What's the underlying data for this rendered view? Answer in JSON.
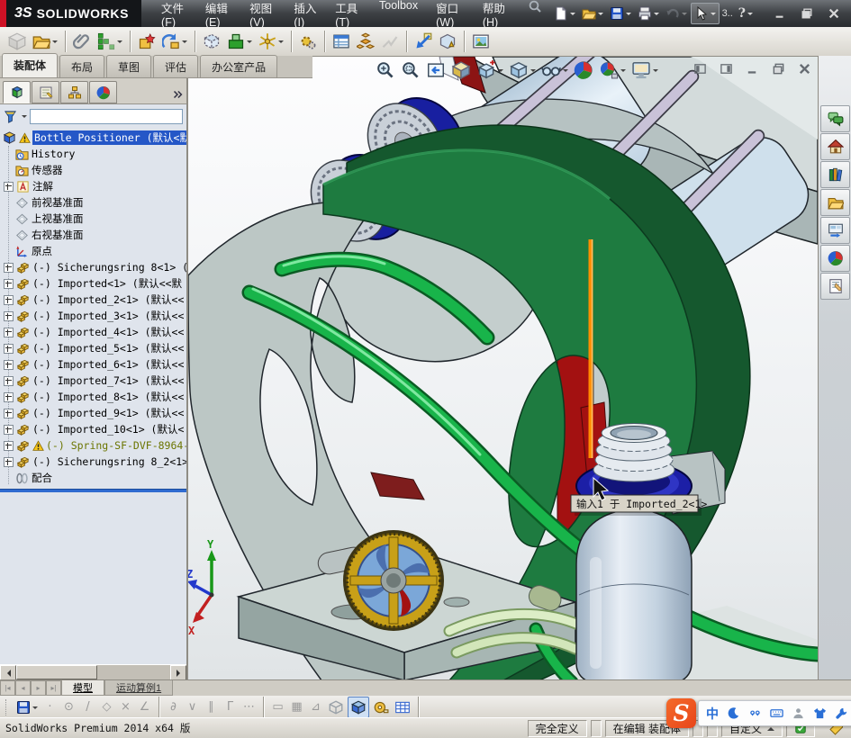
{
  "titlebar": {
    "logo_mark": "3S",
    "logo_text": "SOLIDWORKS",
    "menus": [
      "文件(F)",
      "编辑(E)",
      "视图(V)",
      "插入(I)",
      "工具(T)",
      "Toolbox",
      "窗口(W)",
      "帮助(H)"
    ],
    "quick_tools": [
      "new-document",
      "open-document",
      "save-document",
      "print-document",
      "undo",
      "select-cursor"
    ],
    "select_extra": "3..",
    "help_glyph": "?",
    "window_buttons": [
      "minimize",
      "restore",
      "close"
    ]
  },
  "main_toolbar": {
    "icons": [
      "insert-component",
      "open",
      "mate",
      "linear-component-pattern",
      "smart-fasteners",
      "move-component",
      "show-hidden-components",
      "assembly-features",
      "reference-geometry",
      "new-motion-study",
      "bill-of-materials",
      "exploded-view",
      "explode-line-sketch",
      "interference-detection",
      "assembly-xpert",
      "photo-view"
    ]
  },
  "command_tabs": {
    "items": [
      {
        "label": "装配体"
      },
      {
        "label": "布局"
      },
      {
        "label": "草图"
      },
      {
        "label": "评估"
      },
      {
        "label": "办公室产品"
      }
    ],
    "active": "装配体"
  },
  "feature_panel": {
    "tabs": [
      "featuremanager-design-tree",
      "property-manager",
      "configuration-manager",
      "display-manager"
    ],
    "tree": {
      "rows": [
        {
          "icon": "assembly",
          "warn": true,
          "selected": true,
          "label": "Bottle Positioner (默认<默"
        },
        {
          "icon": "history",
          "label": "History"
        },
        {
          "icon": "sensors",
          "label": "传感器"
        },
        {
          "icon": "annotations",
          "plus": true,
          "label": "注解"
        },
        {
          "icon": "plane",
          "label": "前视基准面"
        },
        {
          "icon": "plane",
          "label": "上视基准面"
        },
        {
          "icon": "plane",
          "label": "右视基准面"
        },
        {
          "icon": "origin",
          "label": "原点"
        },
        {
          "icon": "part",
          "plus": true,
          "label": "(-) Sicherungsring 8<1> (默"
        },
        {
          "icon": "part",
          "plus": true,
          "label": "(-) Imported<1> (默认<<默"
        },
        {
          "icon": "part",
          "plus": true,
          "label": "(-) Imported_2<1> (默认<<"
        },
        {
          "icon": "part",
          "plus": true,
          "label": "(-) Imported_3<1> (默认<<"
        },
        {
          "icon": "part",
          "plus": true,
          "label": "(-) Imported_4<1> (默认<<"
        },
        {
          "icon": "part",
          "plus": true,
          "label": "(-) Imported_5<1> (默认<<"
        },
        {
          "icon": "part",
          "plus": true,
          "label": "(-) Imported_6<1> (默认<<"
        },
        {
          "icon": "part",
          "plus": true,
          "label": "(-) Imported_7<1> (默认<<"
        },
        {
          "icon": "part",
          "plus": true,
          "label": "(-) Imported_8<1> (默认<<"
        },
        {
          "icon": "part",
          "plus": true,
          "label": "(-) Imported_9<1> (默认<<"
        },
        {
          "icon": "part",
          "plus": true,
          "label": "(-) Imported_10<1> (默认<"
        },
        {
          "icon": "part",
          "plus": true,
          "warn": true,
          "olive": true,
          "label": "(-) Spring-SF-DVF-8964-"
        },
        {
          "icon": "part",
          "plus": true,
          "label": "(-) Sicherungsring 8_2<1>"
        },
        {
          "icon": "mates",
          "label": "配合"
        }
      ]
    }
  },
  "headsup": {
    "icons": [
      "zoom-to-fit",
      "zoom-to-area",
      "previous-view",
      "section-view",
      "view-orientation",
      "display-style",
      "hide-show-items",
      "edit-appearance",
      "apply-scene",
      "view-settings"
    ]
  },
  "viewport": {
    "tooltip": "输入1 于 Imported_2<1>",
    "triad": {
      "x": "X",
      "y": "Y",
      "z": "Z"
    },
    "window_buttons": [
      "pane-left",
      "pane-right",
      "minimize-document",
      "restore-document",
      "close-document"
    ]
  },
  "task_pane": {
    "icons": [
      "solidworks-forum",
      "solidworks-resources",
      "design-library",
      "file-explorer",
      "view-palette",
      "appearances-scenes",
      "custom-properties"
    ]
  },
  "bottom_tabs": {
    "items": [
      {
        "label": "模型"
      },
      {
        "label": "运动算例1"
      }
    ],
    "active": "模型"
  },
  "sketch_toolbar": {
    "icons": [
      "save",
      "point",
      "circle",
      "line",
      "polygon",
      "trim",
      "angle",
      "tangent",
      "merge",
      "parallel",
      "perpendicular",
      "trace",
      "rectangle",
      "grid",
      "angle-snap",
      "wire-cube",
      "shaded-cube",
      "measure",
      "table"
    ],
    "glyphs": [
      "·",
      "⊙",
      "/",
      "◇",
      "×",
      "∠",
      "∂",
      "∨",
      "∥",
      "Γ",
      "⋯",
      "▭",
      "▦",
      "⊿"
    ]
  },
  "statusbar": {
    "message": "SolidWorks Premium 2014 x64 版",
    "define_state": "完全定义",
    "edit_state": "在编辑 装配体",
    "custom": "自定义"
  },
  "ime_bar": {
    "brand": "S",
    "mode": "中",
    "icons": [
      "moon",
      "punctuation",
      "keyboard",
      "account",
      "skin",
      "wrench"
    ]
  },
  "colors": {
    "selection": "#2557c7",
    "splitter_blue": "#2f6bd0",
    "tube_green": "#18b44a",
    "plate_green": "#1e7b40",
    "accent_red": "#a31111",
    "orange_trace": "#ff8c00",
    "sogou_orange": "#f4501e",
    "blue_ring": "#1c1fa6"
  }
}
